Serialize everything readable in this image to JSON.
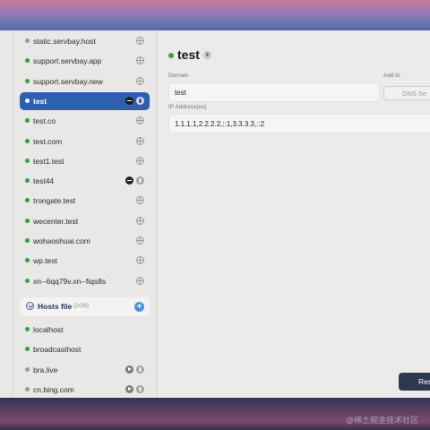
{
  "sidebar": {
    "items": [
      {
        "label": "static.servbay.host",
        "status": "gray",
        "icons": [
          "globe-icon"
        ]
      },
      {
        "label": "support.servbay.app",
        "status": "green",
        "icons": [
          "globe-icon"
        ]
      },
      {
        "label": "support.servbay.new",
        "status": "green",
        "icons": [
          "globe-icon"
        ]
      },
      {
        "label": "test",
        "status": "white",
        "selected": true,
        "icons": [
          "stop-icon",
          "trash-icon"
        ]
      },
      {
        "label": "test.co",
        "status": "green",
        "icons": [
          "globe-icon"
        ]
      },
      {
        "label": "test.com",
        "status": "green",
        "icons": [
          "globe-icon"
        ]
      },
      {
        "label": "test1.test",
        "status": "green",
        "icons": [
          "globe-icon"
        ]
      },
      {
        "label": "test44",
        "status": "green",
        "icons": [
          "stop-icon",
          "trash-icon"
        ]
      },
      {
        "label": "trongate.test",
        "status": "green",
        "icons": [
          "globe-icon"
        ]
      },
      {
        "label": "wecenter.test",
        "status": "green",
        "icons": [
          "globe-icon"
        ]
      },
      {
        "label": "wohaoshuai.com",
        "status": "green",
        "icons": [
          "globe-icon"
        ]
      },
      {
        "label": "wp.test",
        "status": "green",
        "icons": [
          "globe-icon"
        ]
      },
      {
        "label": "xn--6qq79v.xn--fiqs8s",
        "status": "green",
        "icons": [
          "globe-icon"
        ]
      }
    ],
    "hosts_group": {
      "title": "Hosts file",
      "count": "(2/28)",
      "add_icon": "plus-icon"
    },
    "hosts_items": [
      {
        "label": "localhost",
        "status": "green",
        "icons": []
      },
      {
        "label": "broadcasthost",
        "status": "green",
        "icons": []
      },
      {
        "label": "bra.live",
        "status": "gray",
        "icons": [
          "play-icon",
          "trash-icon"
        ]
      },
      {
        "label": "cn.bing.com",
        "status": "gray",
        "icons": [
          "play-icon",
          "trash-icon"
        ]
      }
    ]
  },
  "detail": {
    "title": "test",
    "domain_label": "Domain",
    "domain_value": "test",
    "add_to_label": "Add to",
    "add_to_value": "DNS Se",
    "ip_label": "IP Address(es)",
    "ip_value": "1.1.1.1,2.2.2.2,::1,3.3.3.3,::2",
    "reset_label": "Res"
  },
  "colors": {
    "accent": "#2f5fb1",
    "status_green": "#2da346",
    "status_gray": "#9a9a9a",
    "button_dark": "#2c3750"
  },
  "watermark": "@稀土掘金技术社区"
}
